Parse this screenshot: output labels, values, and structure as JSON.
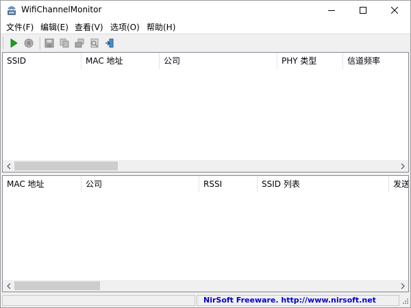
{
  "window": {
    "title": "WifiChannelMonitor"
  },
  "menu": [
    "文件(F)",
    "编辑(E)",
    "查看(V)",
    "选项(O)",
    "帮助(H)"
  ],
  "toolbar": {
    "buttons": [
      "start-capture-icon",
      "stop-capture-icon",
      "save-icon",
      "copy-icon",
      "html-report-icon",
      "properties-icon",
      "exit-icon"
    ]
  },
  "top_table": {
    "columns": [
      "SSID",
      "MAC 地址",
      "公司",
      "PHY 类型",
      "信道频率"
    ]
  },
  "bottom_table": {
    "columns": [
      "MAC 地址",
      "公司",
      "RSSI",
      "SSID 列表",
      "发送帧"
    ]
  },
  "status": {
    "link": "NirSoft Freeware.  http://www.nirsoft.net"
  }
}
